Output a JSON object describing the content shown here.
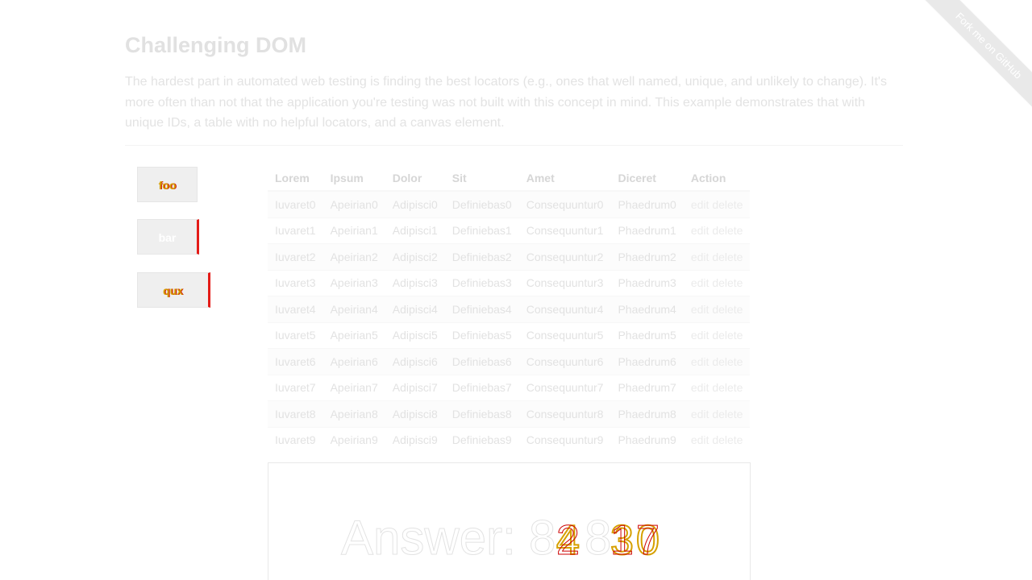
{
  "ribbon": {
    "label": "Fork me on GitHub"
  },
  "page": {
    "title": "Challenging DOM",
    "description": "The hardest part in automated web testing is finding the best locators (e.g., ones that well named, unique, and unlikely to change). It's more often than not that the application you're testing was not built with this concept in mind. This example demonstrates that with unique IDs, a table with no helpful locators, and a canvas element."
  },
  "buttons": [
    {
      "label": "foo",
      "style": "button"
    },
    {
      "label": "bar",
      "style": "button alert"
    },
    {
      "label": "qux",
      "style": "button success"
    }
  ],
  "table": {
    "headers": [
      "Lorem",
      "Ipsum",
      "Dolor",
      "Sit",
      "Amet",
      "Diceret",
      "Action"
    ],
    "rows": [
      [
        "Iuvaret0",
        "Apeirian0",
        "Adipisci0",
        "Definiebas0",
        "Consequuntur0",
        "Phaedrum0"
      ],
      [
        "Iuvaret1",
        "Apeirian1",
        "Adipisci1",
        "Definiebas1",
        "Consequuntur1",
        "Phaedrum1"
      ],
      [
        "Iuvaret2",
        "Apeirian2",
        "Adipisci2",
        "Definiebas2",
        "Consequuntur2",
        "Phaedrum2"
      ],
      [
        "Iuvaret3",
        "Apeirian3",
        "Adipisci3",
        "Definiebas3",
        "Consequuntur3",
        "Phaedrum3"
      ],
      [
        "Iuvaret4",
        "Apeirian4",
        "Adipisci4",
        "Definiebas4",
        "Consequuntur4",
        "Phaedrum4"
      ],
      [
        "Iuvaret5",
        "Apeirian5",
        "Adipisci5",
        "Definiebas5",
        "Consequuntur5",
        "Phaedrum5"
      ],
      [
        "Iuvaret6",
        "Apeirian6",
        "Adipisci6",
        "Definiebas6",
        "Consequuntur6",
        "Phaedrum6"
      ],
      [
        "Iuvaret7",
        "Apeirian7",
        "Adipisci7",
        "Definiebas7",
        "Consequuntur7",
        "Phaedrum7"
      ],
      [
        "Iuvaret8",
        "Apeirian8",
        "Adipisci8",
        "Definiebas8",
        "Consequuntur8",
        "Phaedrum8"
      ],
      [
        "Iuvaret9",
        "Apeirian9",
        "Adipisci9",
        "Definiebas9",
        "Consequuntur9",
        "Phaedrum9"
      ]
    ],
    "action_edit": "edit",
    "action_delete": "delete"
  },
  "canvas": {
    "answer_prefix": "Answer: ",
    "answer_static": "8",
    "answer_overlap_a": "4",
    "answer_overlap_b": "2",
    "answer_mid": "8",
    "answer_overlap_c": "3",
    "answer_overlap_d": "1",
    "answer_overlap_e": "0",
    "answer_overlap_f": "7"
  },
  "colors": {
    "alert_border": "#e41b17",
    "glitch_yellow": "#d6a000",
    "glitch_red": "#cc0000"
  }
}
